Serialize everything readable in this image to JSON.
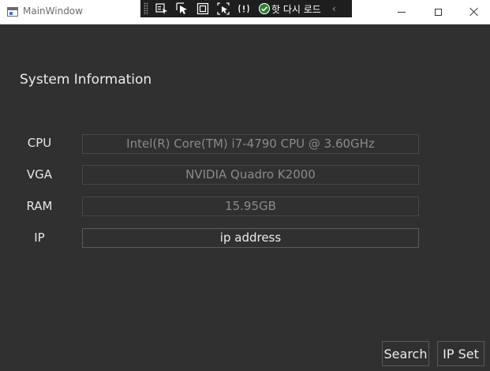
{
  "window": {
    "title": "MainWindow"
  },
  "debug_toolbar": {
    "hot_reload_label": "핫 다시 로드",
    "icons": [
      "select-visual-icon",
      "pointer-select-icon",
      "layout-adorner-icon",
      "track-focus-icon",
      "binding-failures-icon",
      "hot-reload-check-icon",
      "collapse-chevron-icon"
    ]
  },
  "main": {
    "title": "System Information",
    "rows": [
      {
        "label": "CPU",
        "value": "Intel(R) Core(TM) i7-4790 CPU @ 3.60GHz"
      },
      {
        "label": "VGA",
        "value": "NVIDIA Quadro K2000"
      },
      {
        "label": "RAM",
        "value": "15.95GB"
      },
      {
        "label": "IP",
        "value": "ip address"
      }
    ]
  },
  "actions": {
    "search_label": "Search",
    "ipset_label": "IP Set"
  },
  "colors": {
    "background": "#303030",
    "text": "#ececec",
    "readonly_text": "#8a8a8a",
    "border": "#474747"
  }
}
